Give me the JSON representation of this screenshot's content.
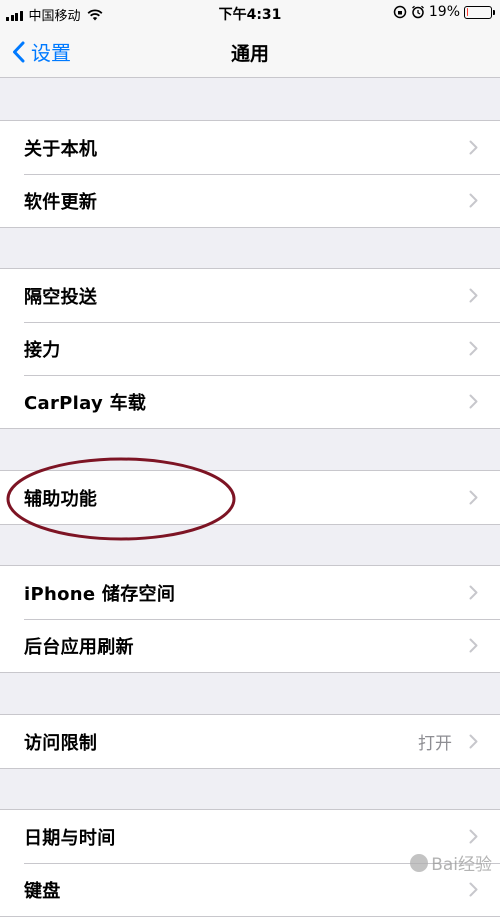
{
  "status_bar": {
    "carrier": "中国移动",
    "time": "下午4:31",
    "battery_percent": "19%",
    "battery_level": 0.19,
    "battery_color": "#ff3b30"
  },
  "nav": {
    "back_label": "设置",
    "title": "通用"
  },
  "groups": [
    {
      "items": [
        {
          "label": "关于本机"
        },
        {
          "label": "软件更新"
        }
      ]
    },
    {
      "items": [
        {
          "label": "隔空投送"
        },
        {
          "label": "接力"
        },
        {
          "label": "CarPlay 车载"
        }
      ]
    },
    {
      "items": [
        {
          "label": "辅助功能"
        }
      ]
    },
    {
      "items": [
        {
          "label": "iPhone 储存空间"
        },
        {
          "label": "后台应用刷新"
        }
      ]
    },
    {
      "items": [
        {
          "label": "访问限制",
          "value": "打开"
        }
      ]
    },
    {
      "items": [
        {
          "label": "日期与时间"
        },
        {
          "label": "键盘"
        }
      ]
    }
  ],
  "annotation": {
    "highlight_color": "#7d1424"
  },
  "watermark": "Bai经验",
  "icons": {
    "back": "chevron-left-icon",
    "row": "chevron-right-icon",
    "wifi": "wifi-icon",
    "alarm": "alarm-icon",
    "battery": "battery-icon"
  },
  "colors": {
    "accent": "#007aff",
    "background": "#efeff4",
    "separator": "#c8c7cc"
  }
}
